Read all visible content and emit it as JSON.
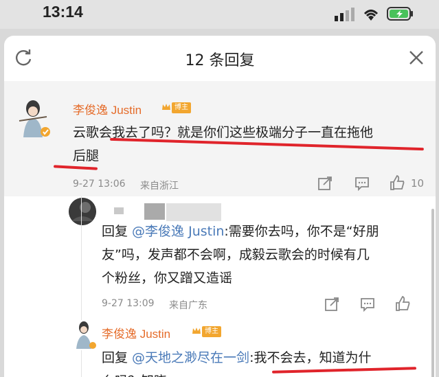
{
  "status_bar": {
    "time": "13:14"
  },
  "header": {
    "title": "12 条回复",
    "refresh_icon": "refresh-icon",
    "close_icon": "close-icon"
  },
  "comments": [
    {
      "user": "李俊逸 Justin",
      "badge": "博主",
      "lines": [
        "云歌会我去了吗？就是你们这些极端分子一直在拖他",
        "后腿"
      ],
      "time": "9-27 13:06",
      "location": "来自浙江",
      "likes": "10"
    },
    {
      "user": "",
      "reply_prefix": "回复 ",
      "reply_to": "@李俊逸 Justin",
      "lines_first": ":需要你去吗，你不是“好朋",
      "lines": [
        "友”吗，发声都不会啊，成毅云歌会的时候有几",
        "个粉丝，你又蹭又造谣"
      ],
      "time": "9-27 13:09",
      "location": "来自广东"
    },
    {
      "user": "李俊逸 Justin",
      "badge": "博主",
      "reply_prefix": "回复 ",
      "reply_to": "@天地之渺尽在一剑",
      "lines_first": ":我不会去，知道为什",
      "lines": [
        "么吗？知晓"
      ]
    }
  ],
  "colors": {
    "accent": "#e56c2a",
    "link": "#4a7ab8",
    "highlight": "#e0242b"
  }
}
